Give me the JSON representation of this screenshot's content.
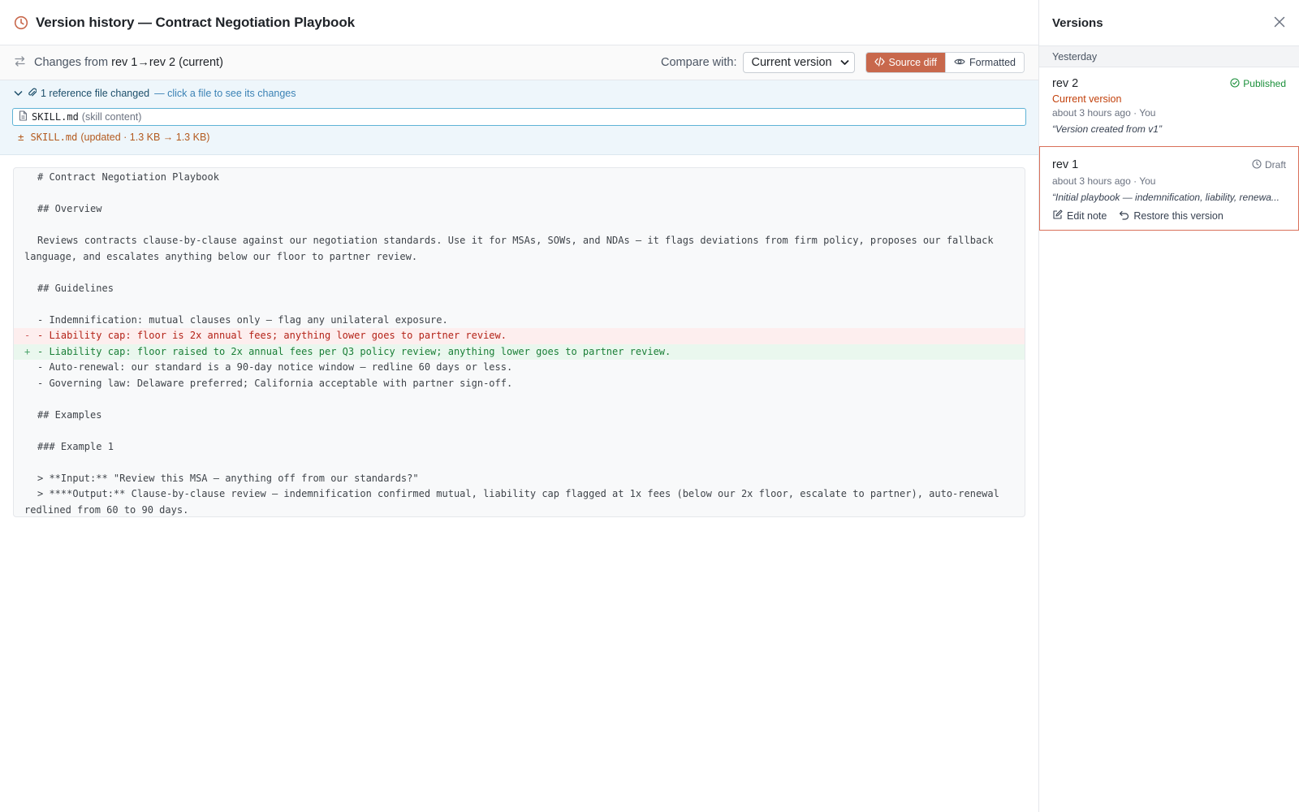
{
  "header": {
    "title": "Version history — Contract Negotiation Playbook",
    "history_icon": "clock-icon"
  },
  "changes": {
    "prefix": "Changes from",
    "from": "rev 1",
    "arrow": "→",
    "to": "rev 2 (current)",
    "compare_label": "Compare with:",
    "compare_value": "Current version",
    "source_diff_label": "Source diff",
    "formatted_label": "Formatted"
  },
  "reference": {
    "count_label": "1 reference file changed",
    "hint": "— click a file to see its changes",
    "file_name": "SKILL.md",
    "file_desc": "(skill content)",
    "stat_marker": "±",
    "stat_name": "SKILL.md",
    "stat_detail": "(updated · 1.3 KB → 1.3 KB)"
  },
  "diff": {
    "lines": [
      {
        "type": "ctx",
        "text": "# Contract Negotiation Playbook"
      },
      {
        "type": "ctx",
        "text": ""
      },
      {
        "type": "ctx",
        "text": "## Overview"
      },
      {
        "type": "ctx",
        "text": ""
      },
      {
        "type": "ctx",
        "text": "Reviews contracts clause-by-clause against our negotiation standards. Use it for MSAs, SOWs, and NDAs — it flags deviations from firm policy, proposes our fallback language, and escalates anything below our floor to partner review."
      },
      {
        "type": "ctx",
        "text": ""
      },
      {
        "type": "ctx",
        "text": "## Guidelines"
      },
      {
        "type": "ctx",
        "text": ""
      },
      {
        "type": "ctx",
        "text": "- Indemnification: mutual clauses only — flag any unilateral exposure."
      },
      {
        "type": "del",
        "text": "- Liability cap: floor is 2x annual fees; anything lower goes to partner review."
      },
      {
        "type": "add",
        "text": "- Liability cap: floor raised to 2x annual fees per Q3 policy review; anything lower goes to partner review."
      },
      {
        "type": "ctx",
        "text": "- Auto-renewal: our standard is a 90-day notice window — redline 60 days or less."
      },
      {
        "type": "ctx",
        "text": "- Governing law: Delaware preferred; California acceptable with partner sign-off."
      },
      {
        "type": "ctx",
        "text": ""
      },
      {
        "type": "ctx",
        "text": "## Examples"
      },
      {
        "type": "ctx",
        "text": ""
      },
      {
        "type": "ctx",
        "text": "### Example 1"
      },
      {
        "type": "ctx",
        "text": ""
      },
      {
        "type": "ctx",
        "text": "> **Input:** \"Review this MSA — anything off from our standards?\""
      },
      {
        "type": "ctx",
        "text": "> ****Output:** Clause-by-clause review — indemnification confirmed mutual, liability cap flagged at 1x fees (below our 2x floor, escalate to partner), auto-renewal redlined from 60 to 90 days."
      }
    ]
  },
  "panel": {
    "title": "Versions",
    "group_label": "Yesterday",
    "versions": [
      {
        "name": "rev 2",
        "status": "Published",
        "current_label": "Current version",
        "meta": "about 3 hours ago · You",
        "note": "“Version created from v1”"
      },
      {
        "name": "rev 1",
        "status": "Draft",
        "meta": "about 3 hours ago · You",
        "note": "“Initial playbook — indemnification, liability, renewa...",
        "edit_label": "Edit note",
        "restore_label": "Restore this version"
      }
    ]
  },
  "colors": {
    "accent": "#c8684c",
    "added": "#1a7f37",
    "removed": "#b42318",
    "published": "#1a8f3a",
    "current": "#c2410c"
  }
}
